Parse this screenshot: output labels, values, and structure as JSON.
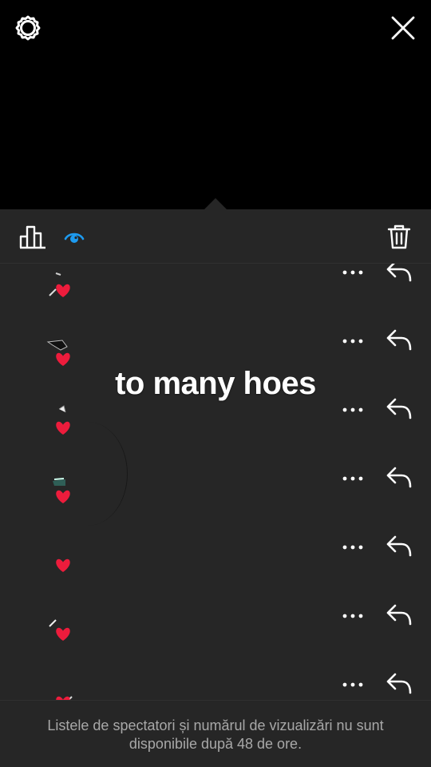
{
  "icons": {
    "settings": "gear-icon",
    "close": "close-icon",
    "stats": "bar-chart-icon",
    "viewers": "eye-icon",
    "delete": "trash-icon",
    "more": "more-horizontal-icon",
    "reply": "reply-arrow-icon",
    "reaction": "heart-icon"
  },
  "colors": {
    "accent": "#1d9bf0",
    "heart": "#ed1c3c",
    "sheet_bg": "#262626"
  },
  "viewers": [
    {
      "reaction": "heart"
    },
    {
      "reaction": "heart"
    },
    {
      "reaction": "heart"
    },
    {
      "reaction": "heart"
    },
    {
      "reaction": "heart"
    },
    {
      "reaction": "heart"
    },
    {
      "reaction": "heart"
    }
  ],
  "overlay_text": "to many hoes",
  "footer_note": "Listele de spectatori și numărul de vizualizări nu sunt disponibile după 48 de ore."
}
